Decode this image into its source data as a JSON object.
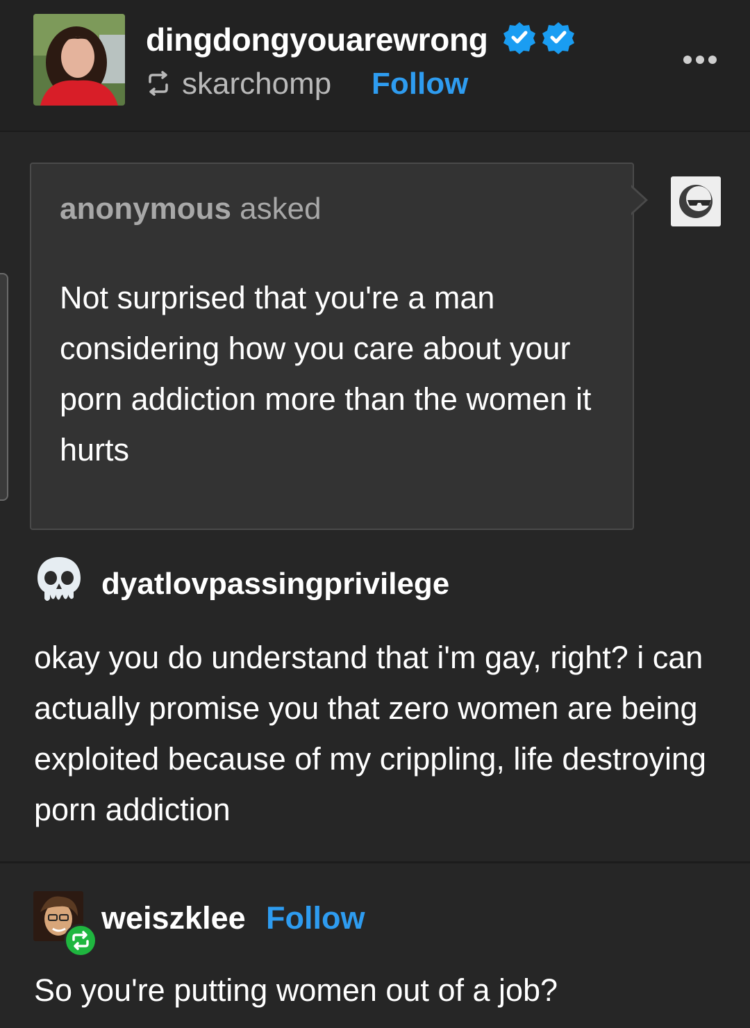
{
  "post": {
    "author": "dingdongyouarewrong",
    "reblogged_from": "skarchomp",
    "follow_label": "Follow",
    "verified_badges": 2
  },
  "ask": {
    "asker": "anonymous",
    "asked_word": "asked",
    "question": "Not surprised that you're a man considering how you care about your porn addiction more than the women it hurts"
  },
  "answer": {
    "author": "dyatlovpassingprivilege",
    "text": "okay you do understand that i'm gay, right? i can actually promise you that zero women are being exploited because of my crippling, life destroying porn addiction"
  },
  "reply": {
    "author": "weiszklee",
    "follow_label": "Follow",
    "text": "So you're putting women out of a job?"
  },
  "colors": {
    "background": "#262626",
    "accent": "#2e9cf0",
    "reblog_badge": "#1fb63f"
  }
}
